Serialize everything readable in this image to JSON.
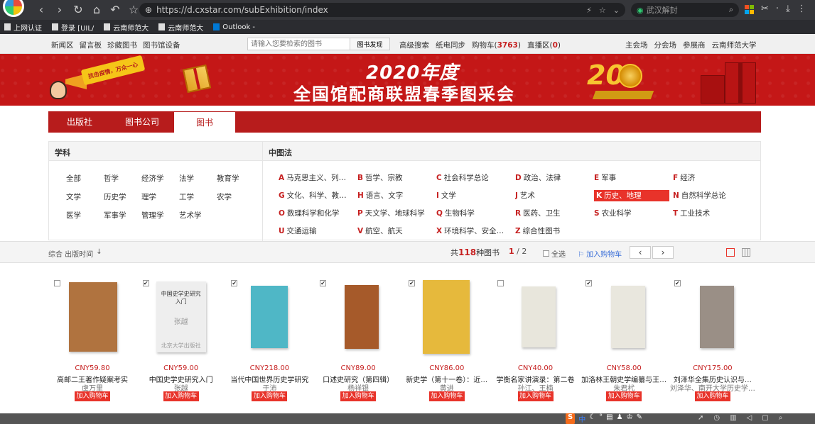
{
  "browser": {
    "url_protocol": "https://",
    "url": "d.cxstar.com/subExhibition/index",
    "search_text": "武汉解封",
    "bookmarks": [
      {
        "label": "上网认证"
      },
      {
        "label": "登录 [UIL/"
      },
      {
        "label": "云南师范大"
      },
      {
        "label": "云南师范大"
      },
      {
        "label": "Outlook -"
      }
    ]
  },
  "site_nav": {
    "left_links": [
      "新闻区",
      "留言板",
      "珍藏图书",
      "图书馆设备"
    ],
    "search_placeholder": "请输入您要检索的图书",
    "search_button": "图书发现",
    "mid_links": [
      "高级搜索",
      "纸电同步"
    ],
    "cart_label": "购物车(",
    "cart_count": "3763",
    "cart_close": ")",
    "live_label": "直播区(",
    "live_count": "0",
    "live_close": ")",
    "right_links": [
      "主会场",
      "分会场",
      "参展商",
      "云南师范大学"
    ]
  },
  "banner": {
    "slogan": "抗击疫情，万众一心",
    "title_line1": "2020年度",
    "title_line2": "全国馆配商联盟春季图采会",
    "badge": "20"
  },
  "category_tabs": [
    {
      "label": "出版社",
      "active": false
    },
    {
      "label": "图书公司",
      "active": false
    },
    {
      "label": "图书",
      "active": true
    }
  ],
  "filters": {
    "subject_header": "学科",
    "clc_header": "中图法",
    "subjects": [
      "全部",
      "哲学",
      "经济学",
      "法学",
      "教育学",
      "文学",
      "历史学",
      "理学",
      "工学",
      "农学",
      "医学",
      "军事学",
      "管理学",
      "艺术学"
    ],
    "clc": [
      {
        "code": "A",
        "name": "马克思主义、列…"
      },
      {
        "code": "B",
        "name": "哲学、宗教"
      },
      {
        "code": "C",
        "name": "社会科学总论"
      },
      {
        "code": "D",
        "name": "政治、法律"
      },
      {
        "code": "E",
        "name": "军事"
      },
      {
        "code": "F",
        "name": "经济"
      },
      {
        "code": "G",
        "name": "文化、科学、教…"
      },
      {
        "code": "H",
        "name": "语言、文字"
      },
      {
        "code": "I",
        "name": "文学"
      },
      {
        "code": "J",
        "name": "艺术"
      },
      {
        "code": "K",
        "name": "历史、地理",
        "active": true
      },
      {
        "code": "N",
        "name": "自然科学总论"
      },
      {
        "code": "O",
        "name": "数理科学和化学"
      },
      {
        "code": "P",
        "name": "天文学、地球科学"
      },
      {
        "code": "Q",
        "name": "生物科学"
      },
      {
        "code": "R",
        "name": "医药、卫生"
      },
      {
        "code": "S",
        "name": "农业科学"
      },
      {
        "code": "T",
        "name": "工业技术"
      },
      {
        "code": "U",
        "name": "交通运输"
      },
      {
        "code": "V",
        "name": "航空、航天"
      },
      {
        "code": "X",
        "name": "环境科学、安全…"
      },
      {
        "code": "Z",
        "name": "综合性图书"
      }
    ]
  },
  "results": {
    "sort_label": "综合 出版时间",
    "total_prefix": "共",
    "total": "118",
    "total_suffix": "种图书",
    "page_current": "1",
    "page_total": "/ 2",
    "select_all": "全选",
    "add_cart": "加入购物车"
  },
  "books": [
    {
      "price": "CNY59.80",
      "title": "高邮二王著作疑案考实",
      "author": "虞万里",
      "checked": false,
      "cover_color": "#b0733f"
    },
    {
      "price": "CNY59.00",
      "title": "中国史学史研究入门",
      "author": "张越",
      "checked": true,
      "cover_color": "#eeeeee",
      "cover_text": "中国史学史研究入门",
      "cover_sub": "张越",
      "cover_foot": "北京大学出版社"
    },
    {
      "price": "CNY218.00",
      "title": "当代中国世界历史学研究",
      "author": "于沛",
      "checked": true,
      "cover_color": "#4fb7c6"
    },
    {
      "price": "CNY89.00",
      "title": "口述史研究（第四辑）",
      "author": "杨祥银",
      "checked": true,
      "cover_color": "#a65a2a"
    },
    {
      "price": "CNY86.00",
      "title": "新史学（第十一卷）：近…",
      "author": "黄进",
      "checked": true,
      "cover_color": "#e6b93c"
    },
    {
      "price": "CNY40.00",
      "title": "学衡名家讲演录：第二卷",
      "author": "孙江、王楠",
      "checked": false,
      "cover_color": "#e8e6dc"
    },
    {
      "price": "CNY58.00",
      "title": "加洛林王朝史学编纂与王…",
      "author": "朱君杙",
      "checked": true,
      "cover_color": "#e9e7de"
    },
    {
      "price": "CNY175.00",
      "title": "刘泽华全集历史认识与…",
      "author": "刘泽华、南开大学历史学…",
      "checked": true,
      "cover_color": "#9a8f86"
    }
  ],
  "book_add_label": "加入购物车",
  "taskbar": {
    "ime_label": "中"
  }
}
